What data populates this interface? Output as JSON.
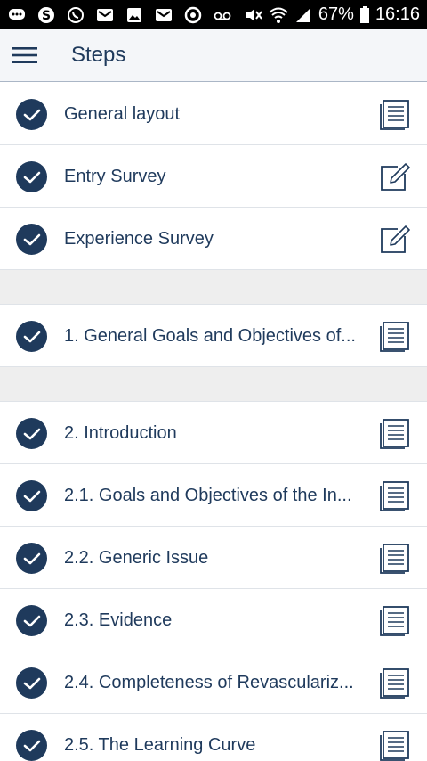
{
  "status_bar": {
    "battery": "67%",
    "time": "16:16",
    "left_icons": [
      "chat-icon",
      "skype-icon",
      "whatsapp-icon",
      "gmail-icon",
      "image-icon",
      "gmail-icon",
      "sync-icon",
      "voicemail-icon"
    ],
    "right_icons": [
      "mute-icon",
      "wifi-icon",
      "signal-icon",
      "battery-icon"
    ]
  },
  "app_bar": {
    "title": "Steps",
    "menu_icon": "hamburger-menu-icon"
  },
  "colors": {
    "primary": "#1f3a5c",
    "separator": "#eeeeee",
    "app_bar_bg": "#f4f6f9"
  },
  "list": [
    {
      "type": "item",
      "label": "General layout",
      "status_icon": "check-circle-icon",
      "action_icon": "document-icon"
    },
    {
      "type": "item",
      "label": "Entry Survey",
      "status_icon": "check-circle-icon",
      "action_icon": "edit-icon"
    },
    {
      "type": "item",
      "label": "Experience Survey",
      "status_icon": "check-circle-icon",
      "action_icon": "edit-icon"
    },
    {
      "type": "separator"
    },
    {
      "type": "item",
      "label": "1. General Goals and Objectives of...",
      "status_icon": "check-circle-icon",
      "action_icon": "document-icon"
    },
    {
      "type": "separator"
    },
    {
      "type": "item",
      "label": "2. Introduction",
      "status_icon": "check-circle-icon",
      "action_icon": "document-icon"
    },
    {
      "type": "item",
      "label": "2.1. Goals and Objectives of the In...",
      "status_icon": "check-circle-icon",
      "action_icon": "document-icon"
    },
    {
      "type": "item",
      "label": "2.2. Generic Issue",
      "status_icon": "check-circle-icon",
      "action_icon": "document-icon"
    },
    {
      "type": "item",
      "label": "2.3. Evidence",
      "status_icon": "check-circle-icon",
      "action_icon": "document-icon"
    },
    {
      "type": "item",
      "label": "2.4. Completeness of Revasculariz...",
      "status_icon": "check-circle-icon",
      "action_icon": "document-icon"
    },
    {
      "type": "item",
      "label": "2.5. The Learning Curve",
      "status_icon": "check-circle-icon",
      "action_icon": "document-icon"
    }
  ]
}
